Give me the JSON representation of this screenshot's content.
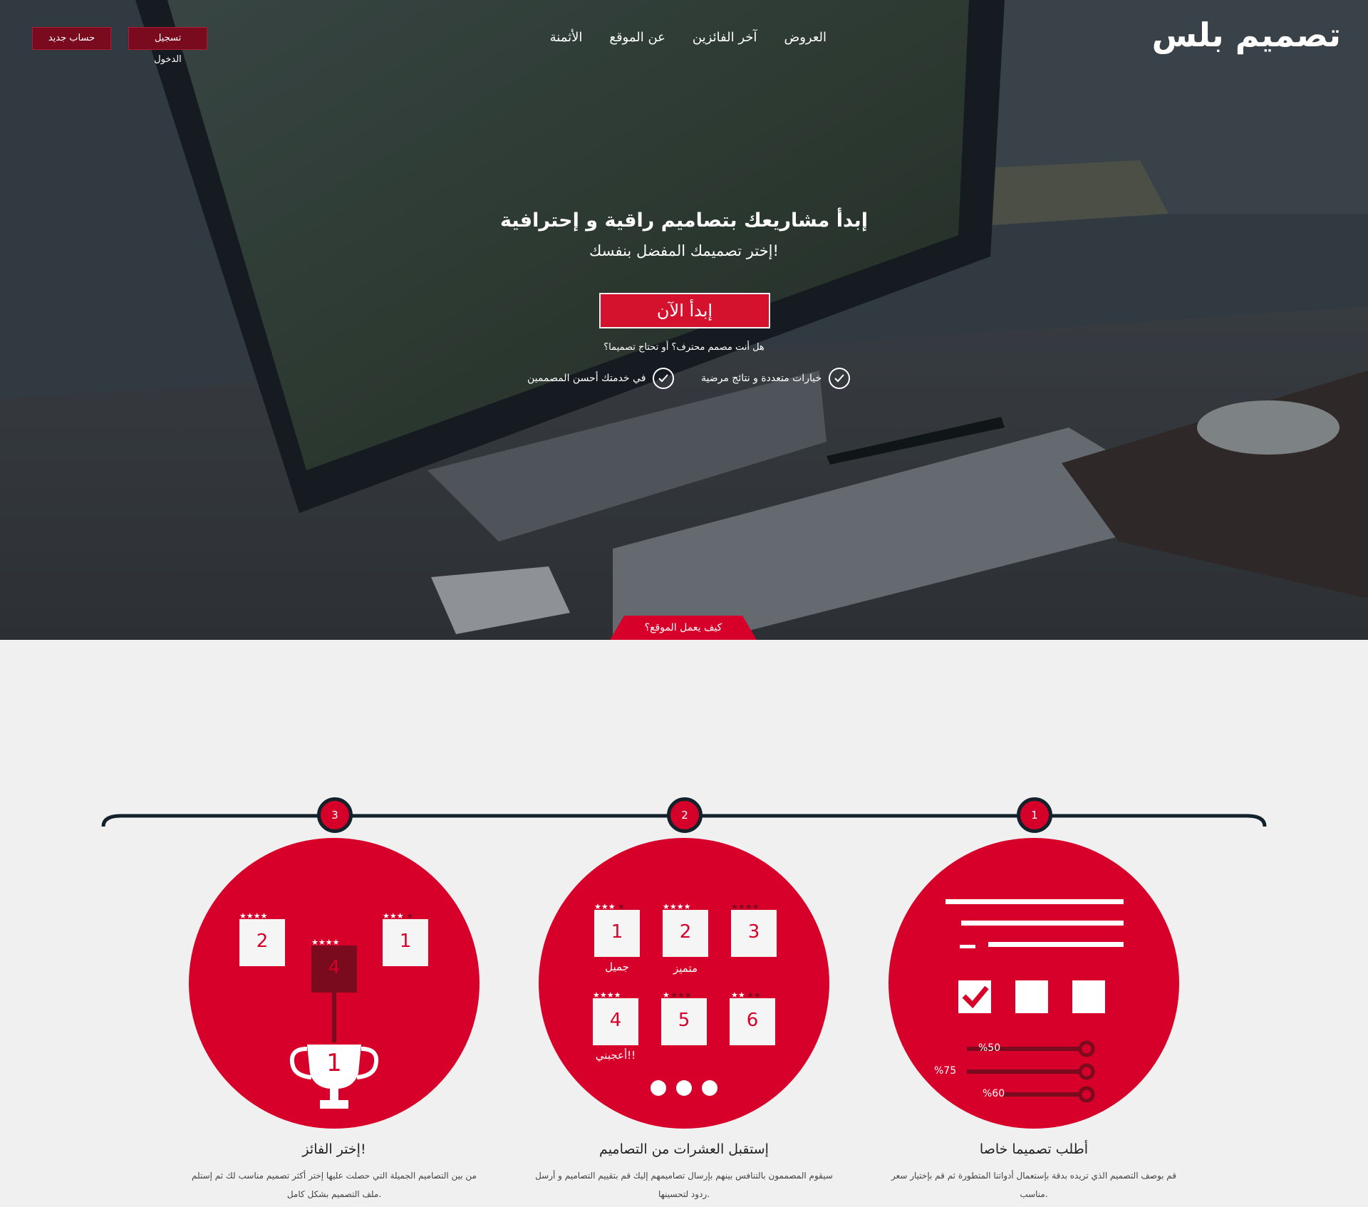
{
  "header": {
    "logo": "تصميم بلس",
    "nav": [
      "العروض",
      "آخر الفائزين",
      "عن الموقع",
      "الأثمنة"
    ],
    "login_label": "تسجيل الدخول",
    "signup_label": "حساب جديد"
  },
  "hero": {
    "headline": "إبدأ مشاريعك بتصاميم راقية و إحترافية",
    "subheadline": "إختر تصميمك المفضل بنفسك!",
    "cta_label": "إبدأ الآن",
    "question": "هل أنت مصمم محترف؟ أو تحتاج تصميما؟",
    "features": [
      "خيارات متعددة و نتائج مرضية",
      "في خدمتك أحسن المصممين"
    ],
    "how_label": "كيف يعمل الموقع؟"
  },
  "steps": [
    {
      "number": "1",
      "title": "أطلب تصميما خاصا",
      "text": "قم بوصف التصميم الذي تريده بدقة بإستعمال أدواتنا المتطورة ثم قم بإختيار سعر مناسب.",
      "percents": [
        "%50",
        "%75",
        "%60"
      ]
    },
    {
      "number": "2",
      "title": "إستقبل العشرات من التصاميم",
      "text": "سيقوم المصممون بالتنافس بينهم بإرسال تصاميمهم إليك قم بتقييم التصاميم و أرسل ردود لتحسينها.",
      "cards": [
        "1",
        "2",
        "3",
        "4",
        "5",
        "6"
      ],
      "card_labels": [
        "جميل",
        "متميز",
        "أعجبني!!"
      ]
    },
    {
      "number": "3",
      "title": "إختر الفائز!",
      "text": "من بين التصاميم الجميلة التي حصلت عليها إختر أكثر تصميم مناسب لك ثم إستلم ملف التصميم بشكل كامل.",
      "cards": [
        "1",
        "2",
        "4"
      ],
      "trophy": "1"
    }
  ],
  "colors": {
    "brand_red": "#d7002a",
    "dark_red": "#7a0a1d",
    "navy": "#12212a"
  }
}
